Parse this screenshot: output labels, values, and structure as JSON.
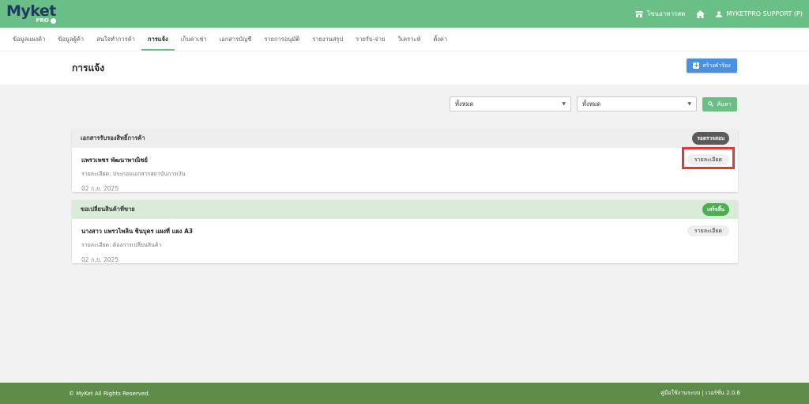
{
  "app": {
    "logo_main": "Myket",
    "logo_sub": "PRO"
  },
  "topbar": {
    "shop_label": "โซนอาหารสด",
    "user_label": "MYKETPRO SUPPORT (P)",
    "icons": [
      "store-icon",
      "home-icon",
      "user-icon"
    ]
  },
  "nav": {
    "tabs": [
      {
        "label": "ข้อมูลแผงค้า",
        "active": false
      },
      {
        "label": "ข้อมูลผู้ค้า",
        "active": false
      },
      {
        "label": "สนใจทำการค้า",
        "active": false
      },
      {
        "label": "การแจ้ง",
        "active": true
      },
      {
        "label": "เก็บค่าเช่า",
        "active": false
      },
      {
        "label": "เอกสารบัญชี",
        "active": false
      },
      {
        "label": "รายการอนุมัติ",
        "active": false
      },
      {
        "label": "รายงานสรุป",
        "active": false
      },
      {
        "label": "รายรับ-จ่าย",
        "active": false
      },
      {
        "label": "วิเคราะห์",
        "active": false
      },
      {
        "label": "ตั้งค่า",
        "active": false
      }
    ]
  },
  "header": {
    "title": "การแจ้ง",
    "create_label": "สร้างคำร้อง"
  },
  "filters": {
    "select1_value": "ทั้งหมด",
    "select2_value": "ทั้งหมด",
    "search_label": "ค้นหา"
  },
  "cards": [
    {
      "title": "เอกสารรับรองสิทธิ์การค้า",
      "status": "รอตรวจสอบ",
      "name": "แพรวเพชร พัฒนาพาณิชย์",
      "detail": "รายละเอียด: ประกอบเอกสารสถาบันการเงิน",
      "date": "02 ก.ย. 2025",
      "button": "รายละเอียด"
    },
    {
      "title": "ขอเปลี่ยนสินค้าที่ขาย",
      "status": "เสร็จสิ้น",
      "name": "นางสาว แพรวไพลิน ชินบุตร แผงที่ แผง A3",
      "detail": "รายละเอียด: ต้องการเปลี่ยนสินค้า",
      "date": "02 ก.ย. 2025",
      "button": "รายละเอียด"
    }
  ],
  "footer": {
    "copyright": "© MyKet All Rights Reserved.",
    "version": "คู่มือใช้งานระบบ | เวอร์ชั่น 2.0.6"
  },
  "colors": {
    "brand_green": "#6abf86",
    "footer_green": "#5e8d4a",
    "primary_blue": "#4a90e2",
    "highlight_red": "#e53935"
  }
}
